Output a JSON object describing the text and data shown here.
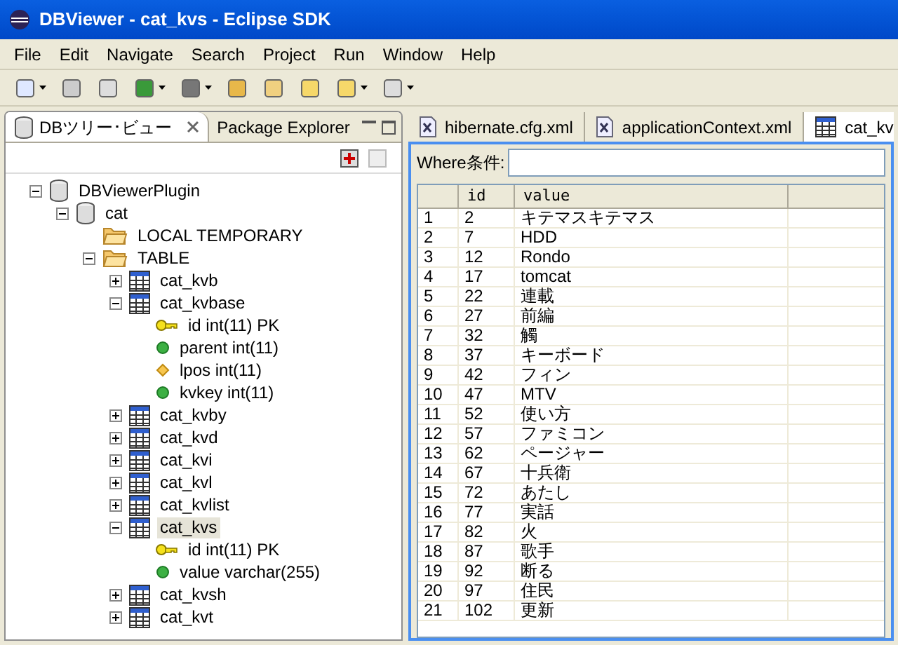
{
  "window": {
    "title": "DBViewer - cat_kvs - Eclipse SDK"
  },
  "menu": [
    "File",
    "Edit",
    "Navigate",
    "Search",
    "Project",
    "Run",
    "Window",
    "Help"
  ],
  "left_view": {
    "tabs": [
      {
        "label": "DBツリー･ビュー",
        "selected": true,
        "kind": "db"
      },
      {
        "label": "Package Explorer",
        "selected": false,
        "kind": "plain"
      }
    ],
    "tree": [
      {
        "label": "DBViewerPlugin",
        "kind": "db",
        "expanded": true,
        "selected": false,
        "children": [
          {
            "label": "cat",
            "kind": "db",
            "expanded": true,
            "selected": false,
            "children": [
              {
                "label": "LOCAL TEMPORARY",
                "kind": "folder",
                "selected": false
              },
              {
                "label": "TABLE",
                "kind": "folder",
                "expanded": true,
                "selected": false,
                "children": [
                  {
                    "label": "cat_kvb",
                    "kind": "table",
                    "expanded": false,
                    "selected": false
                  },
                  {
                    "label": "cat_kvbase",
                    "kind": "table",
                    "expanded": true,
                    "selected": false,
                    "children": [
                      {
                        "label": "id int(11) PK",
                        "kind": "key",
                        "selected": false
                      },
                      {
                        "label": "parent int(11)",
                        "kind": "column",
                        "selected": false
                      },
                      {
                        "label": "lpos int(11)",
                        "kind": "index",
                        "selected": false
                      },
                      {
                        "label": "kvkey int(11)",
                        "kind": "column",
                        "selected": false
                      }
                    ]
                  },
                  {
                    "label": "cat_kvby",
                    "kind": "table",
                    "expanded": false,
                    "selected": false
                  },
                  {
                    "label": "cat_kvd",
                    "kind": "table",
                    "expanded": false,
                    "selected": false
                  },
                  {
                    "label": "cat_kvi",
                    "kind": "table",
                    "expanded": false,
                    "selected": false
                  },
                  {
                    "label": "cat_kvl",
                    "kind": "table",
                    "expanded": false,
                    "selected": false
                  },
                  {
                    "label": "cat_kvlist",
                    "kind": "table",
                    "expanded": false,
                    "selected": false
                  },
                  {
                    "label": "cat_kvs",
                    "kind": "table",
                    "expanded": true,
                    "selected": true,
                    "children": [
                      {
                        "label": "id int(11) PK",
                        "kind": "key",
                        "selected": false
                      },
                      {
                        "label": "value varchar(255)",
                        "kind": "column",
                        "selected": false
                      }
                    ]
                  },
                  {
                    "label": "cat_kvsh",
                    "kind": "table",
                    "expanded": false,
                    "selected": false
                  },
                  {
                    "label": "cat_kvt",
                    "kind": "table",
                    "expanded": false,
                    "selected": false
                  }
                ]
              }
            ]
          }
        ]
      }
    ]
  },
  "editor": {
    "tabs": [
      {
        "label": "hibernate.cfg.xml",
        "selected": false,
        "kind": "xml"
      },
      {
        "label": "applicationContext.xml",
        "selected": false,
        "kind": "xml"
      },
      {
        "label": "cat_kv",
        "selected": true,
        "kind": "table"
      }
    ],
    "where_label": "Where条件:",
    "table": {
      "columns": [
        "",
        "id",
        "value"
      ],
      "rows": [
        [
          "1",
          "2",
          "キテマスキテマス"
        ],
        [
          "2",
          "7",
          "HDD"
        ],
        [
          "3",
          "12",
          "Rondo"
        ],
        [
          "4",
          "17",
          "tomcat"
        ],
        [
          "5",
          "22",
          "連載"
        ],
        [
          "6",
          "27",
          "前編"
        ],
        [
          "7",
          "32",
          "觸"
        ],
        [
          "8",
          "37",
          "キーボード"
        ],
        [
          "9",
          "42",
          "フィン"
        ],
        [
          "10",
          "47",
          "MTV"
        ],
        [
          "11",
          "52",
          "使い方"
        ],
        [
          "12",
          "57",
          "ファミコン"
        ],
        [
          "13",
          "62",
          "ページャー"
        ],
        [
          "14",
          "67",
          "十兵衛"
        ],
        [
          "15",
          "72",
          "あたし"
        ],
        [
          "16",
          "77",
          "実話"
        ],
        [
          "17",
          "82",
          "火"
        ],
        [
          "18",
          "87",
          "歌手"
        ],
        [
          "19",
          "92",
          "断る"
        ],
        [
          "20",
          "97",
          "住民"
        ],
        [
          "21",
          "102",
          "更新"
        ]
      ]
    }
  }
}
